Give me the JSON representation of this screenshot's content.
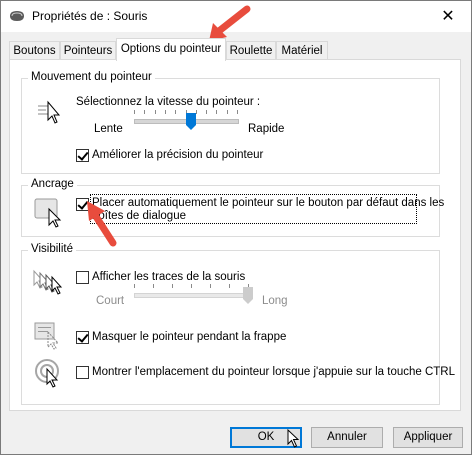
{
  "window": {
    "title": "Propriétés de : Souris",
    "close_glyph": "✕"
  },
  "tabs": [
    {
      "label": "Boutons"
    },
    {
      "label": "Pointeurs"
    },
    {
      "label": "Options du pointeur"
    },
    {
      "label": "Roulette"
    },
    {
      "label": "Matériel"
    }
  ],
  "active_tab": "Options du pointeur",
  "motion": {
    "title": "Mouvement du pointeur",
    "speed_label": "Sélectionnez la vitesse du pointeur :",
    "slow_label": "Lente",
    "fast_label": "Rapide",
    "speed_value": 0.55,
    "precision_label": "Améliorer la précision du pointeur",
    "precision_checked": true
  },
  "snap": {
    "title": "Ancrage",
    "label_line1": "Placer automatiquement le pointeur sur le bouton par défaut dans les",
    "label_line2": "boîtes de dialogue",
    "checked": true
  },
  "visibility": {
    "title": "Visibilité",
    "trails_label": "Afficher les traces de la souris",
    "trails_checked": false,
    "short_label": "Court",
    "long_label": "Long",
    "trails_value": 1.0,
    "hide_label": "Masquer le pointeur pendant la frappe",
    "hide_checked": true,
    "ctrl_label": "Montrer l'emplacement du pointeur lorsque j'appuie sur la touche CTRL",
    "ctrl_checked": false
  },
  "buttons": {
    "ok": "OK",
    "cancel": "Annuler",
    "apply": "Appliquer"
  },
  "colors": {
    "accent": "#0078d7",
    "annotation_arrow": "#e84c3d"
  }
}
